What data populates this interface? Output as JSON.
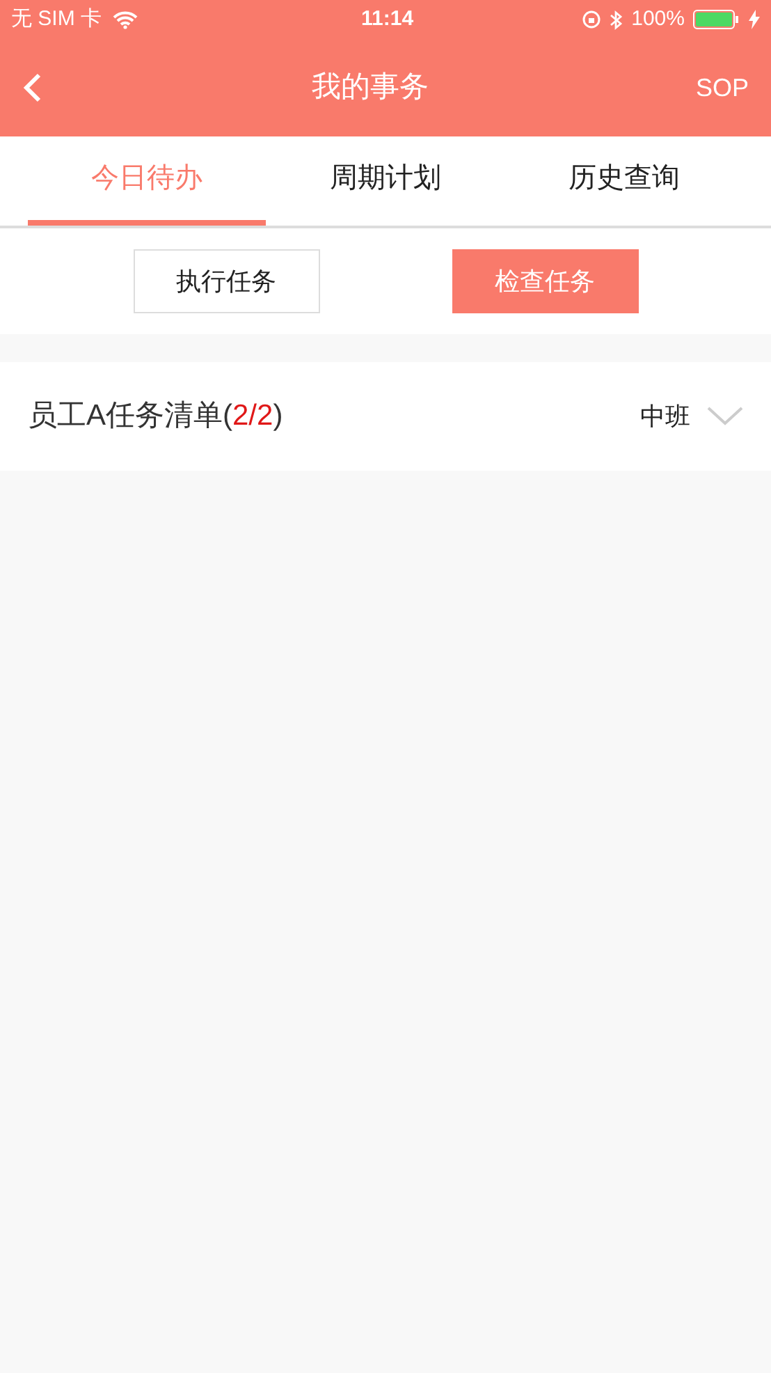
{
  "status_bar": {
    "carrier": "无 SIM 卡",
    "time": "11:14",
    "battery": "100%"
  },
  "nav": {
    "title": "我的事务",
    "action": "SOP"
  },
  "tabs": [
    {
      "label": "今日待办",
      "selected": true
    },
    {
      "label": "周期计划",
      "selected": false
    },
    {
      "label": "历史查询",
      "selected": false
    }
  ],
  "mode_buttons": [
    {
      "label": "执行任务",
      "selected": false
    },
    {
      "label": "检查任务",
      "selected": true
    }
  ],
  "task_list": {
    "title": "员工A任务清单(",
    "count": "2/2",
    "title_end": ")",
    "shift": "中班",
    "expanded": false
  }
}
